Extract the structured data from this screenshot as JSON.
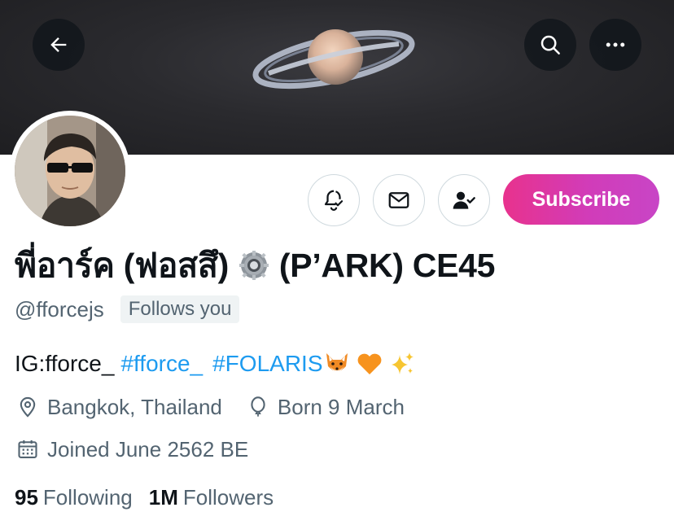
{
  "header": {
    "back_label": "Back",
    "search_label": "Search",
    "more_label": "More"
  },
  "actions": {
    "subscribe_label": "Subscribe"
  },
  "profile": {
    "name_thai": "พี่อาร์ค (ฟอสสึ)",
    "name_latin": "(P’ARK) CE45",
    "name_emoji": "gear-icon",
    "handle": "@fforcejs",
    "follows_you": "Follows you",
    "bio": {
      "prefix": "IG:fforce_",
      "hashtags": [
        "#fforce_",
        "#FOLARIS"
      ],
      "emojis": [
        "fox-emoji",
        "orange-heart-emoji",
        "sparkles-emoji"
      ]
    },
    "location": "Bangkok, Thailand",
    "birthday": "Born 9 March",
    "joined": "Joined June 2562 BE"
  },
  "stats": {
    "following_count": "95",
    "following_label": "Following",
    "followers_count": "1M",
    "followers_label": "Followers"
  },
  "colors": {
    "text_primary": "#0f1419",
    "text_secondary": "#536471",
    "link": "#1d9bf0",
    "subscribe_gradient_start": "#e8328d",
    "subscribe_gradient_end": "#c845c6",
    "border": "#cfd9de"
  }
}
